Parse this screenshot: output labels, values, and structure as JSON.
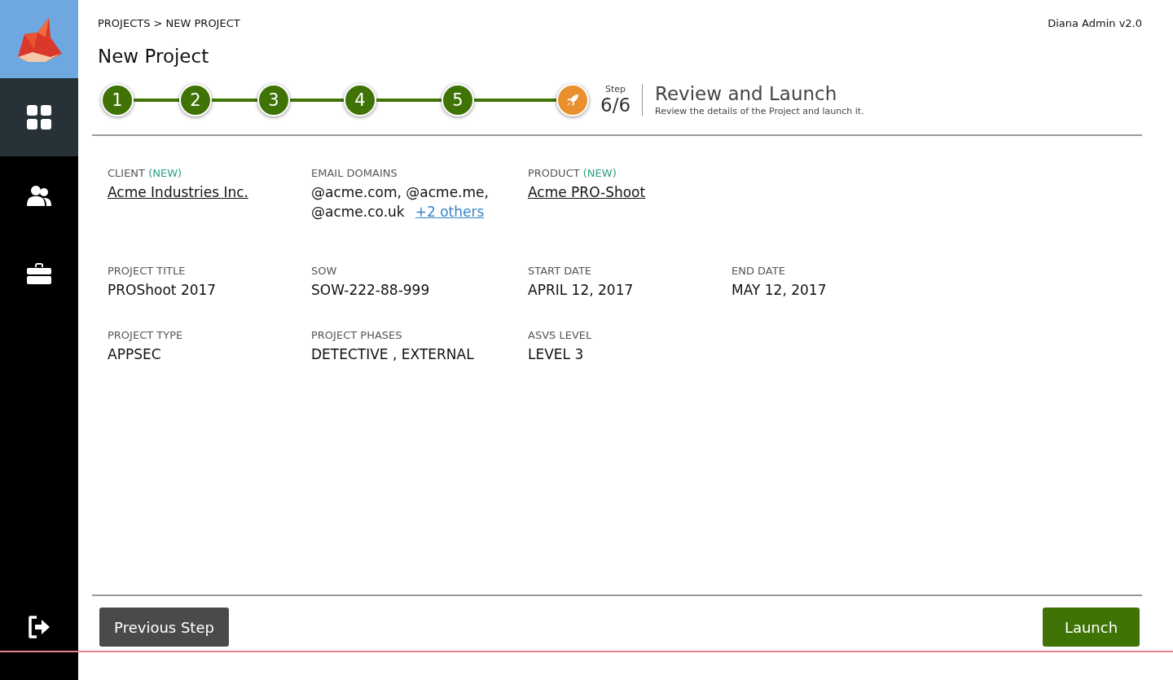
{
  "sidebar": {
    "items": [
      {
        "kind": "dashboard",
        "selected": true
      },
      {
        "kind": "users",
        "selected": false
      },
      {
        "kind": "briefcase",
        "selected": false
      }
    ],
    "bottom_item": {
      "kind": "logout"
    }
  },
  "breadcrumb": "PROJECTS > NEW PROJECT",
  "version": "Diana Admin v2.0",
  "title": "New Project",
  "stepper": {
    "steps": [
      {
        "label": "1",
        "current": false
      },
      {
        "label": "2",
        "current": false
      },
      {
        "label": "3",
        "current": false
      },
      {
        "label": "4",
        "current": false
      },
      {
        "label": "5",
        "current": false
      },
      {
        "current": true
      }
    ],
    "step_caption": "Step",
    "step_count": "6/6",
    "step_title": "Review and Launch",
    "step_description": "Review the details of the Project and launch it."
  },
  "fields": [
    [
      {
        "label": "CLIENT",
        "tag": "(NEW)",
        "kind": "link",
        "value": "Acme Industries Inc."
      },
      {
        "label": "EMAIL DOMAINS",
        "kind": "list",
        "value": "@acme.com, @acme.me, @acme.co.uk",
        "more": "+2 others"
      },
      {
        "label": "PRODUCT",
        "tag": "(NEW)",
        "kind": "link",
        "value": "Acme PRO-Shoot"
      }
    ],
    [
      {
        "label": "PROJECT TITLE",
        "kind": "text",
        "value": "PROShoot 2017"
      },
      {
        "label": "SOW",
        "kind": "text",
        "value": "SOW-222-88-999"
      },
      {
        "label": "START DATE",
        "kind": "text",
        "value": "APRIL 12, 2017"
      },
      {
        "label": "END DATE",
        "kind": "text",
        "value": "MAY 12, 2017"
      }
    ],
    [
      {
        "label": "PROJECT TYPE",
        "kind": "text",
        "value": "APPSEC"
      },
      {
        "label": "PROJECT PHASES",
        "kind": "text",
        "value": "DETECTIVE , EXTERNAL"
      },
      {
        "label": "ASVS LEVEL",
        "kind": "text",
        "value": "LEVEL 3"
      }
    ]
  ],
  "buttons": {
    "previous": "Previous Step",
    "launch": "Launch"
  }
}
